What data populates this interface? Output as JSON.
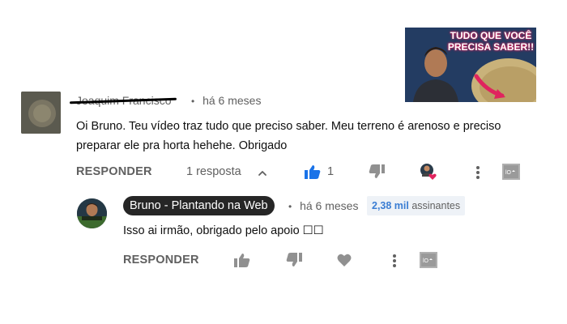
{
  "thumbnail": {
    "title": "TUDO QUE VOCÊ PRECISA SABER!!"
  },
  "comment": {
    "author": "Joaquim Francisco",
    "separator": "•",
    "time": "há 6 meses",
    "text": "Oi Bruno. Teu vídeo traz tudo que preciso saber. Meu terreno é arenoso e preciso preparar ele pra horta hehehe. Obrigado",
    "reply_label": "RESPONDER",
    "replies_label": "1 resposta",
    "like_count": "1"
  },
  "reply": {
    "author": "Bruno - Plantando na Web",
    "separator": "•",
    "time": "há 6 meses",
    "subscribers_count": "2,38 mil",
    "subscribers_label": "assinantes",
    "text": "Isso ai irmão, obrigado pelo apoio ☐☐",
    "reply_label": "RESPONDER"
  },
  "colors": {
    "like_active": "#1a73e8",
    "icon_gray": "#909090",
    "heart_red": "#e0245e"
  },
  "icons": [
    "thumb-up-icon",
    "thumb-down-icon",
    "creator-heart-icon",
    "more-vert-icon",
    "translate-icon",
    "chevron-up-icon",
    "heart-icon"
  ]
}
